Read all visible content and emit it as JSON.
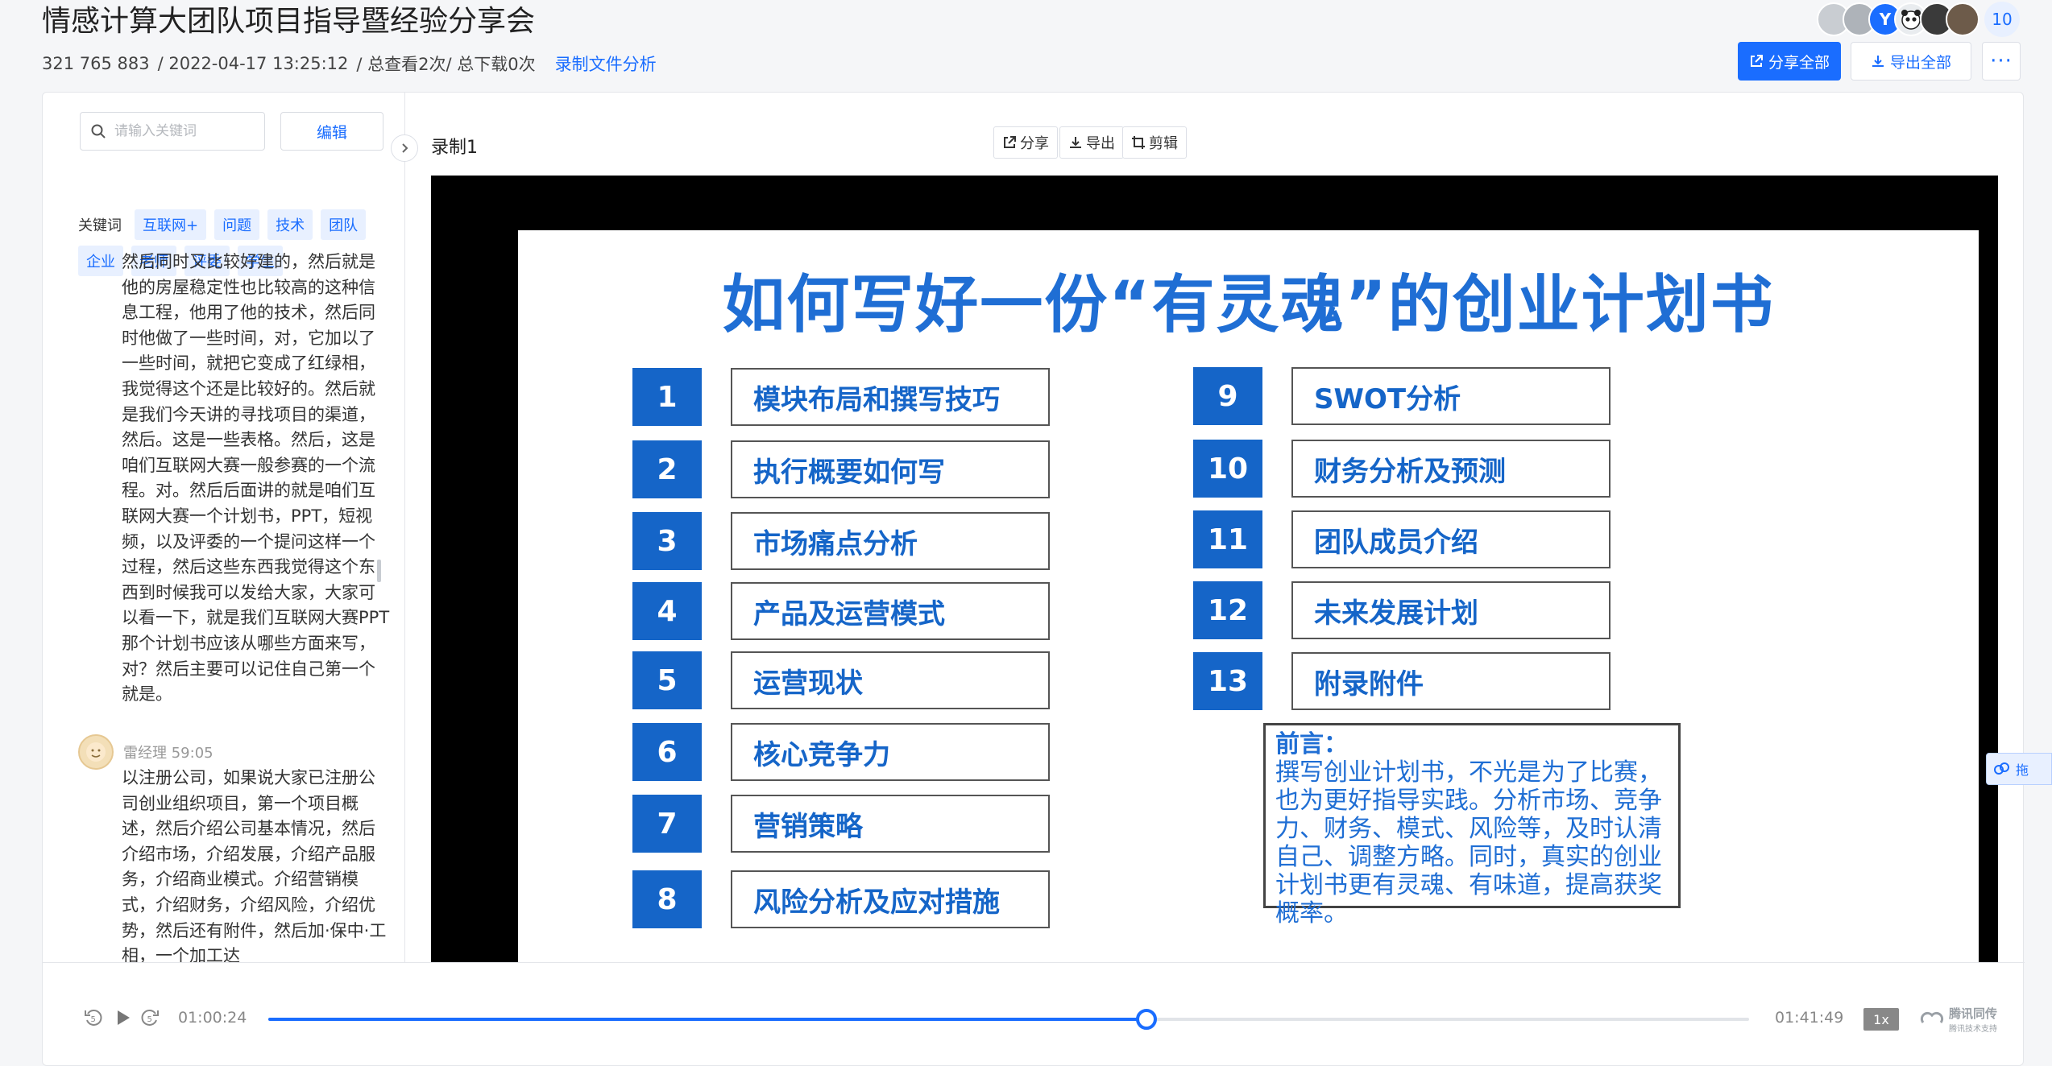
{
  "header": {
    "title": "情感计算大团队项目指导暨经验分享会",
    "meeting_id": "321 765 883",
    "datetime": "/ 2022-04-17 13:25:12",
    "stats": "/ 总查看2次/ 总下载0次",
    "analysis_link": "录制文件分析",
    "avatar_initial": "Y",
    "participant_count": "10",
    "share_all_label": "分享全部",
    "export_all_label": "导出全部",
    "more_label": "···"
  },
  "sidebar": {
    "search_placeholder": "请输入关键词",
    "edit_label": "编辑",
    "keywords_label": "关键词",
    "keywords_row1": [
      "互联网+",
      "问题",
      "技术",
      "团队"
    ],
    "keywords_row2": [
      "企业",
      "老师",
      "评委",
      "学生"
    ],
    "transcript_block1": "然后同时又比较好建的，然后就是他的房屋稳定性也比较高的这种信息工程，他用了他的技术，然后同时他做了一些时间，对，它加以了一些时间，就把它变成了红绿相，我觉得这个还是比较好的。然后就是我们今天讲的寻找项目的渠道，然后。这是一些表格。然后，这是咱们互联网大赛一般参赛的一个流程。对。然后后面讲的就是咱们互联网大赛一个计划书，PPT，短视频，以及评委的一个提问这样一个过程，然后这些东西我觉得这个东西到时候我可以发给大家，大家可以看一下，就是我们互联网大赛PPT那个计划书应该从哪些方面来写，对？然后主要可以记住自己第一个就是。",
    "speaker_name": "雷经理 59:05",
    "transcript_block2": "以注册公司，如果说大家已注册公司创业组织项目，第一个项目概述，然后介绍公司基本情况，然后介绍市场，介绍发展，介绍产品服务，介绍商业模式。介绍营销模式，介绍财务，介绍风险，介绍优势，然后还有附件，然后加·保中·工相，一个加工达"
  },
  "recording": {
    "title": "录制1",
    "share_label": "分享",
    "export_label": "导出",
    "clip_label": "剪辑",
    "float_label": "拖"
  },
  "slide": {
    "title": "如何写好一份“有灵魂”的创业计划书",
    "left_items": [
      {
        "num": "1",
        "label": "模块布局和撰写技巧"
      },
      {
        "num": "2",
        "label": "执行概要如何写"
      },
      {
        "num": "3",
        "label": "市场痛点分析"
      },
      {
        "num": "4",
        "label": "产品及运营模式"
      },
      {
        "num": "5",
        "label": "运营现状"
      },
      {
        "num": "6",
        "label": "核心竞争力"
      },
      {
        "num": "7",
        "label": "营销策略"
      },
      {
        "num": "8",
        "label": "风险分析及应对措施"
      }
    ],
    "right_items": [
      {
        "num": "9",
        "label": "SWOT分析"
      },
      {
        "num": "10",
        "label": "财务分析及预测"
      },
      {
        "num": "11",
        "label": "团队成员介绍"
      },
      {
        "num": "12",
        "label": "未来发展计划"
      },
      {
        "num": "13",
        "label": "附录附件"
      }
    ],
    "preface_heading": "前言：",
    "preface_text": "撰写创业计划书，不光是为了比赛，也为更好指导实践。分析市场、竞争力、财务、模式、风险等，及时认清自己、调整方略。同时，真实的创业计划书更有灵魂、有味道，提高获奖概率。"
  },
  "player": {
    "current_time": "01:00:24",
    "total_time": "01:41:49",
    "progress_fraction": 0.5932,
    "speed_label": "1x",
    "brand_name": "腾讯同传",
    "brand_sub": "腾讯技术支持"
  },
  "colors": {
    "accent": "#1a6dff",
    "slide_blue": "#1565c8"
  }
}
